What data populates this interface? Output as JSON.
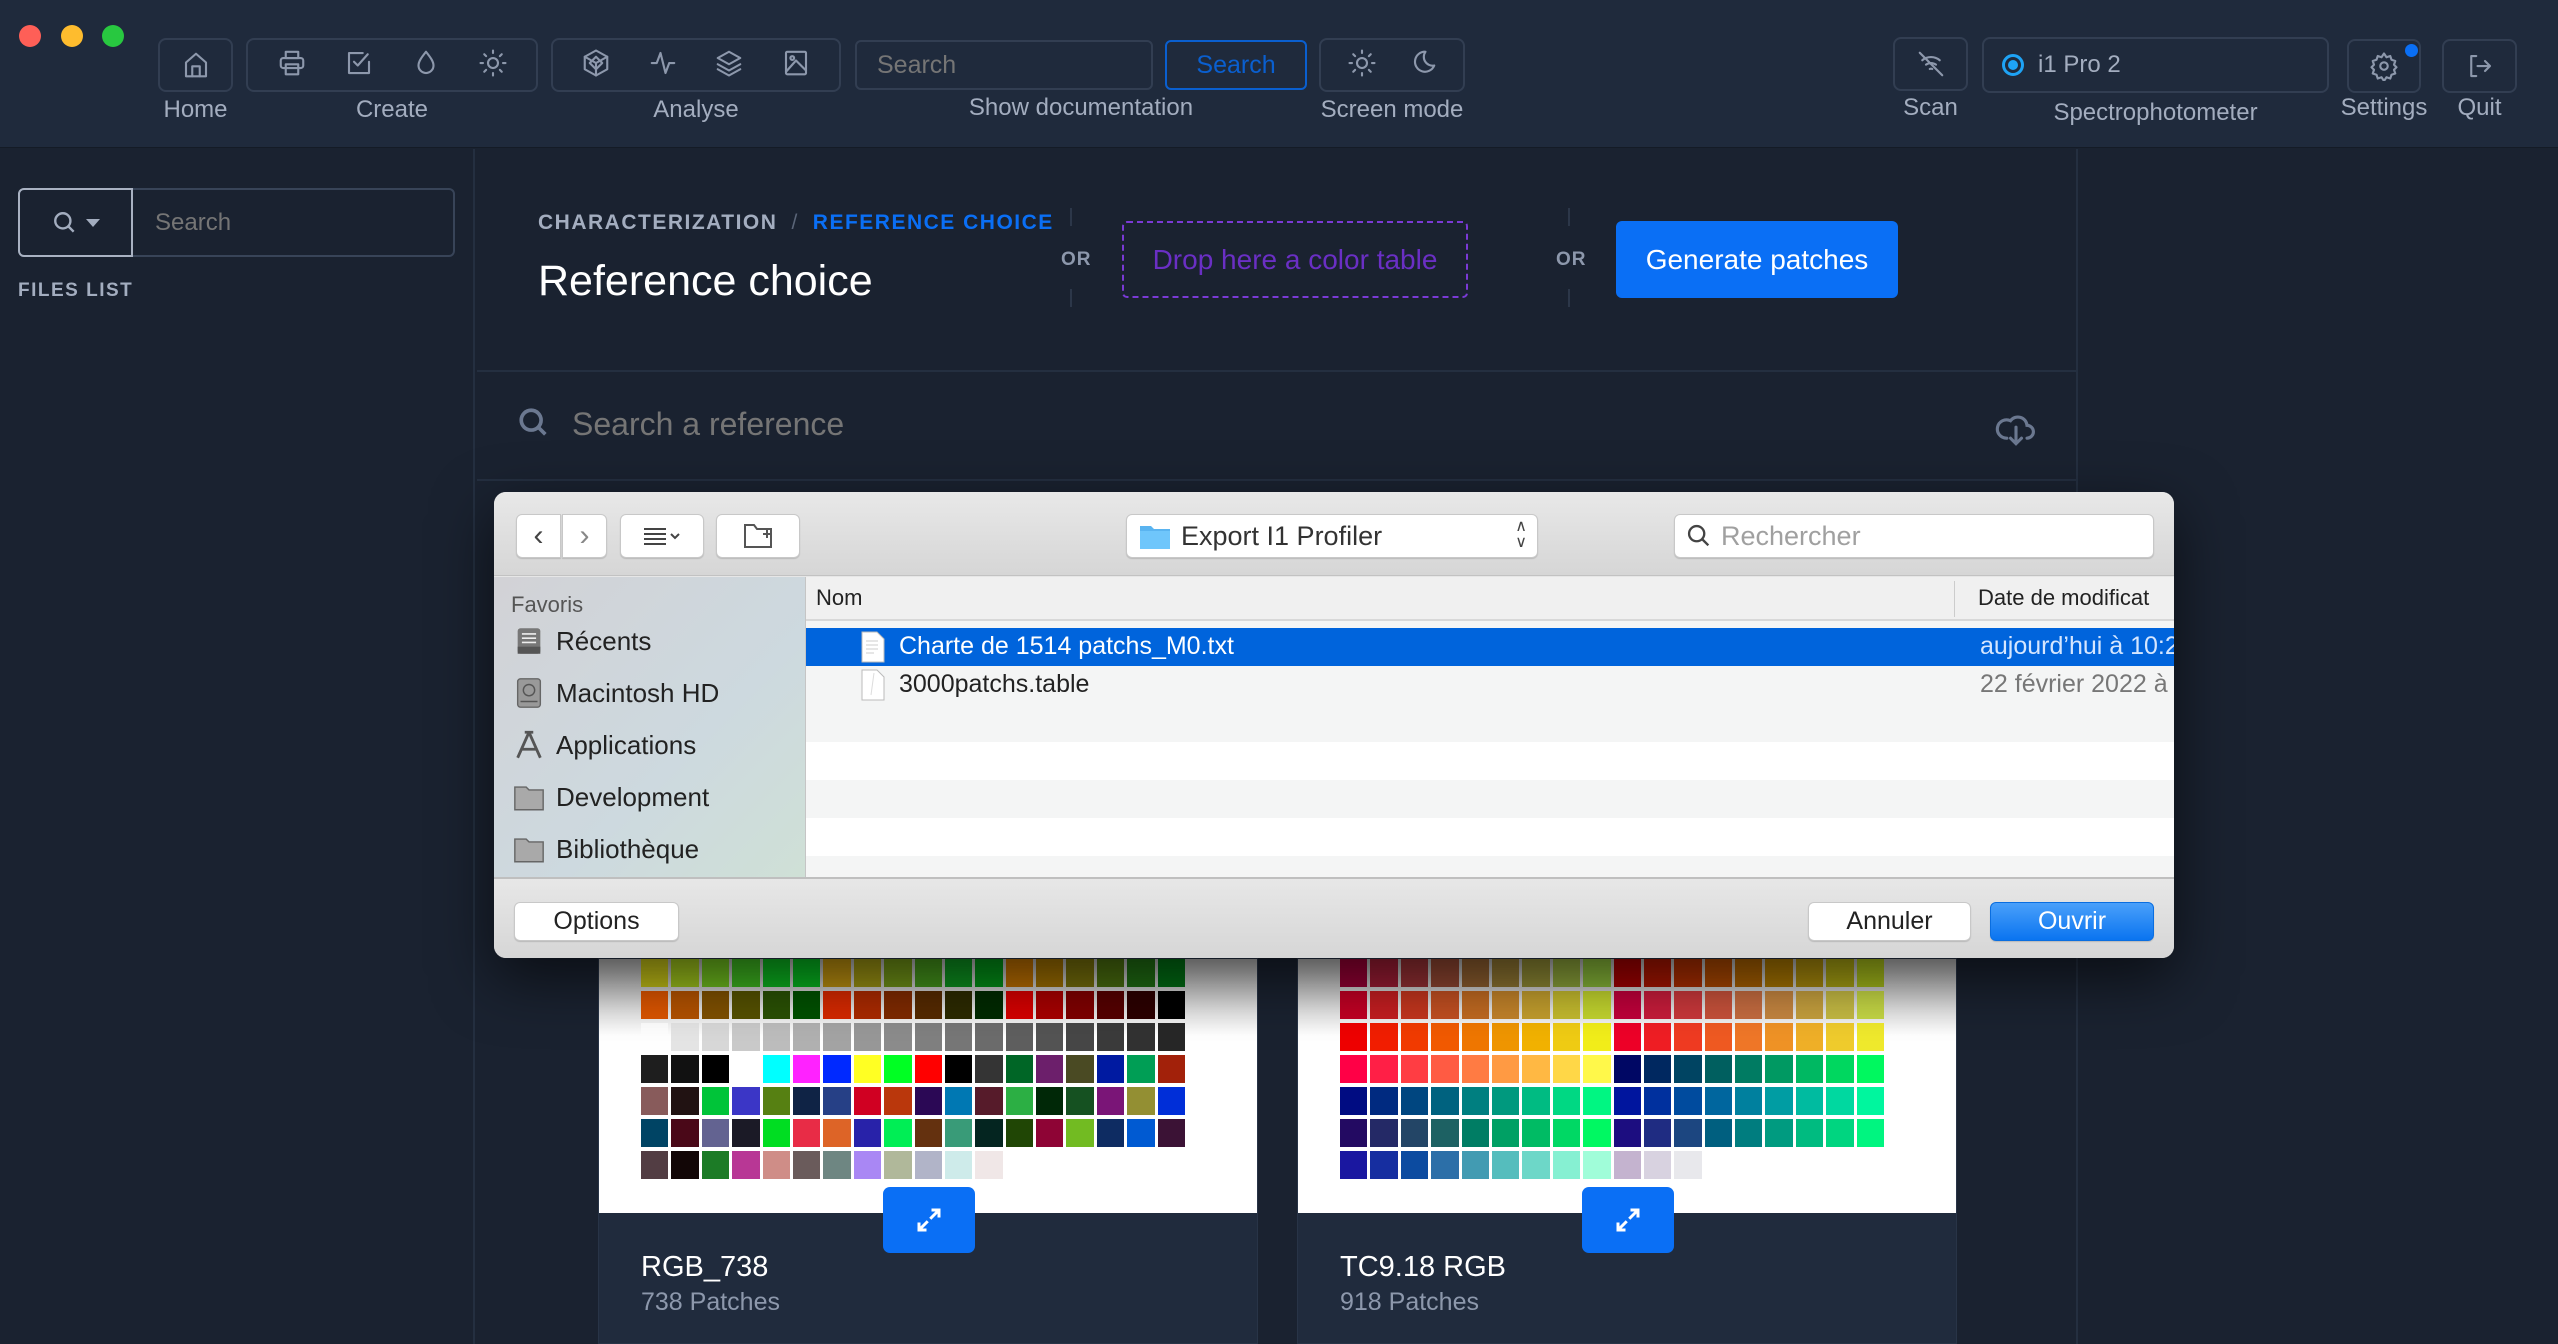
{
  "window": {
    "traffic_lights": {
      "close": "#fe5f57",
      "minimize": "#febc2e",
      "zoom": "#28c840"
    }
  },
  "toolbar": {
    "home_label": "Home",
    "create_label": "Create",
    "analyse_label": "Analyse",
    "doc_search_placeholder": "Search",
    "doc_search_button": "Search",
    "show_documentation_label": "Show documentation",
    "screen_mode_label": "Screen mode",
    "scan_label": "Scan",
    "device_name": "i1 Pro 2",
    "spectrophotometer_label": "Spectrophotometer",
    "settings_label": "Settings",
    "quit_label": "Quit",
    "icons": {
      "home": "home-icon",
      "create": [
        "printer-icon",
        "checkbox-icon",
        "drop-icon",
        "sun-icon"
      ],
      "analyse": [
        "gamut-icon",
        "activity-icon",
        "layers-icon",
        "image-icon"
      ],
      "screen_mode": [
        "sun-icon",
        "moon-icon"
      ],
      "scan": "wifi-off-icon",
      "settings": "gear-icon",
      "quit": "logout-icon"
    }
  },
  "sidebar": {
    "search_placeholder": "Search",
    "files_list_label": "FILES LIST"
  },
  "main": {
    "breadcrumb": {
      "parent": "CHARACTERIZATION",
      "separator": "/",
      "current": "REFERENCE CHOICE"
    },
    "title": "Reference choice",
    "or_1": "OR",
    "drop_zone_label": "Drop here a color table",
    "or_2": "OR",
    "generate_button": "Generate patches",
    "reference_search_placeholder": "Search a reference",
    "accent": "#0a6ff5",
    "drop_color": "#7a3ad6"
  },
  "dialog": {
    "location": "Export I1 Profiler",
    "search_placeholder": "Rechercher",
    "favorites_header": "Favoris",
    "favorites": [
      "Récents",
      "Macintosh HD",
      "Applications",
      "Development",
      "Bibliothèque"
    ],
    "columns": {
      "name": "Nom",
      "date": "Date de modificat"
    },
    "files": [
      {
        "name": "Charte de 1514 patchs_M0.txt",
        "date": "aujourd’hui à 10:2",
        "selected": true
      },
      {
        "name": "3000patchs.table",
        "date": "22 février 2022 à",
        "selected": false
      }
    ],
    "options_button": "Options",
    "cancel_button": "Annuler",
    "open_button": "Ouvrir"
  },
  "cards": [
    {
      "title": "RGB_738",
      "subtitle": "738 Patches",
      "patches": [
        "#bfbc17",
        "#99bd1b",
        "#6cb91d",
        "#3cb11f",
        "#0bb01f",
        "#06b11f",
        "#b78c0f",
        "#978f12",
        "#6d8f16",
        "#42901a",
        "#0d8e1f",
        "#038c17",
        "#b76c00",
        "#9a6c00",
        "#736c0a",
        "#486b0e",
        "#1f6a12",
        "#006b13",
        "#dc5500",
        "#b35200",
        "#7f5000",
        "#555100",
        "#2a5104",
        "#005100",
        "#d62900",
        "#ab2a00",
        "#7f2a00",
        "#562a00",
        "#2c2a00",
        "#002a00",
        "#d60000",
        "#a80000",
        "#800000",
        "#560000",
        "#2c0000",
        "#000000",
        "#ffffff",
        "#e5e5e5",
        "#d8d8d8",
        "#cacaca",
        "#bdbdbd",
        "#b1b1b1",
        "#a4a4a4",
        "#989898",
        "#8c8c8c",
        "#808080",
        "#777777",
        "#6c6c6c",
        "#5f5f5f",
        "#545454",
        "#474747",
        "#3b3b3b",
        "#323232",
        "#272727",
        "#1e1e1e",
        "#111111",
        "#000000",
        "#ffffff",
        "#00ffff",
        "#ff22ff",
        "#0029ff",
        "#ffff23",
        "#00ff23",
        "#ff0000",
        "#000000",
        "#343434",
        "#006626",
        "#6c1f6b",
        "#4a4a23",
        "#001aa1",
        "#009e55",
        "#a2210a",
        "#885b5b",
        "#211212",
        "#00c439",
        "#3b36c6",
        "#568012",
        "#0f2345",
        "#264086",
        "#d00022",
        "#ba370c",
        "#2b0855",
        "#0078b3",
        "#561b2a",
        "#2caf44",
        "#002807",
        "#155121",
        "#7a1577",
        "#938f33",
        "#002ed8",
        "#004464",
        "#4a0818",
        "#636391",
        "#1b1a26",
        "#00dd22",
        "#e82c46",
        "#dd6427",
        "#2822a9",
        "#00ee55",
        "#64310f",
        "#399b78",
        "#042520",
        "#204605",
        "#8e0435",
        "#72bb22",
        "#0e2c62",
        "#005ad2",
        "#3b1235",
        "#523d43",
        "#120606",
        "#1c7b26",
        "#b83795",
        "#cf8d87",
        "#6a5b5b",
        "#6e8682",
        "#a987f4",
        "#b0b89a",
        "#b1b4c8",
        "#ceebea",
        "#f0e7e7"
      ]
    },
    {
      "title": "TC9.18 RGB",
      "subtitle": "918 Patches",
      "patches": [
        "#930033",
        "#991c33",
        "#932f33",
        "#8e4530",
        "#8c5d2e",
        "#8c7330",
        "#8c8733",
        "#8aa039",
        "#86b538",
        "#a00000",
        "#a51500",
        "#a82d00",
        "#a84600",
        "#a55e00",
        "#a57300",
        "#a5870b",
        "#a59f12",
        "#a3b81a",
        "#c20024",
        "#c41e21",
        "#c4361e",
        "#c24f21",
        "#c16a21",
        "#c3832a",
        "#c39e2d",
        "#c5bb2e",
        "#c3d52e",
        "#c1003b",
        "#c81c3b",
        "#ca383b",
        "#c8523b",
        "#c66c40",
        "#c68640",
        "#c6a03e",
        "#c6bb44",
        "#c6d845",
        "#ef0000",
        "#f21e00",
        "#f23b00",
        "#f25a00",
        "#f07700",
        "#f09600",
        "#f2b200",
        "#f0cc14",
        "#f2ee1a",
        "#ee0028",
        "#f01e24",
        "#f03b22",
        "#f05a22",
        "#f07728",
        "#f09326",
        "#f0b028",
        "#f0cc2d",
        "#f0ea2d",
        "#ff0046",
        "#ff1f46",
        "#ff3d43",
        "#ff5b43",
        "#ff7b43",
        "#ff9a43",
        "#ffb843",
        "#ffd747",
        "#fff84a",
        "#000764",
        "#002860",
        "#004462",
        "#005f5f",
        "#007b62",
        "#009962",
        "#00b862",
        "#00d75f",
        "#00f85f",
        "#000c82",
        "#002a80",
        "#004680",
        "#00627f",
        "#007f80",
        "#00997e",
        "#00bb82",
        "#00d883",
        "#00f682",
        "#00159e",
        "#00309e",
        "#004b9e",
        "#00669e",
        "#00809e",
        "#009da3",
        "#00bba0",
        "#00d8a0",
        "#00f69e",
        "#230a62",
        "#242966",
        "#234566",
        "#1d6163",
        "#007d64",
        "#00a064",
        "#00bb64",
        "#00d864",
        "#00f862",
        "#1c0d80",
        "#1f2c82",
        "#1c4680",
        "#005f7f",
        "#007d7f",
        "#009b80",
        "#00bb80",
        "#00d580",
        "#00f580",
        "#1a17a0",
        "#162ea0",
        "#0c4ba0",
        "#2c6fa8",
        "#429bb2",
        "#55bdbd",
        "#6dd7c8",
        "#86f0d2",
        "#a0fdd9",
        "#c4b3cf",
        "#d8d2e0",
        "#e8e8ec"
      ]
    }
  ]
}
